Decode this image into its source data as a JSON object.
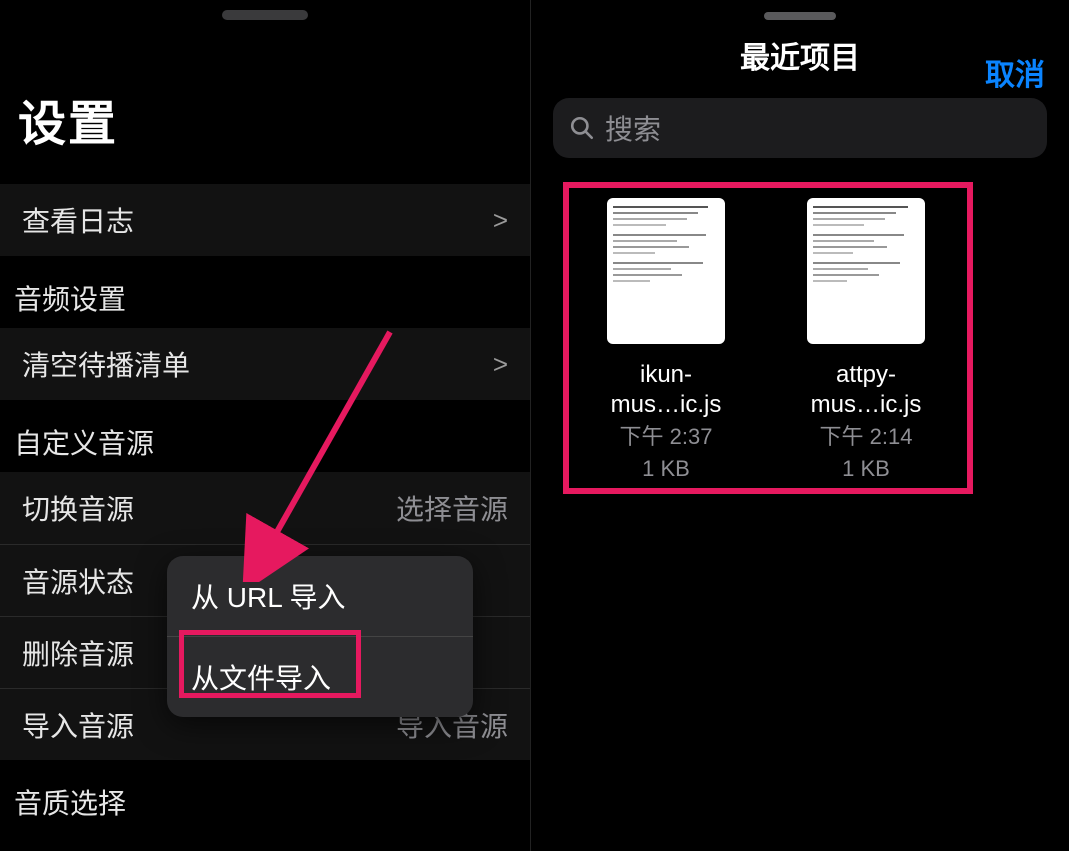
{
  "left": {
    "title": "设置",
    "groups": [
      {
        "rows": [
          {
            "label": "查看日志",
            "chevron": ">"
          }
        ]
      },
      {
        "title": "音频设置",
        "rows": [
          {
            "label": "清空待播清单",
            "chevron": ">"
          }
        ]
      },
      {
        "title": "自定义音源",
        "rows": [
          {
            "label": "切换音源",
            "value": "选择音源"
          },
          {
            "label": "音源状态",
            "value": ""
          },
          {
            "label": "删除音源",
            "value": ""
          },
          {
            "label": "导入音源",
            "value": "导入音源"
          }
        ]
      },
      {
        "title": "音质选择",
        "rows": []
      }
    ],
    "popup": {
      "items": [
        "从 URL 导入",
        "从文件导入"
      ]
    }
  },
  "right": {
    "title": "最近项目",
    "cancel": "取消",
    "search_placeholder": "搜索",
    "files": [
      {
        "name": "ikun-\nmus…ic.js",
        "time": "下午 2:37",
        "size": "1 KB"
      },
      {
        "name": "attpy-\nmus…ic.js",
        "time": "下午 2:14",
        "size": "1 KB"
      }
    ]
  },
  "colors": {
    "accent": "#0a84ff",
    "highlight": "#e6195f"
  }
}
